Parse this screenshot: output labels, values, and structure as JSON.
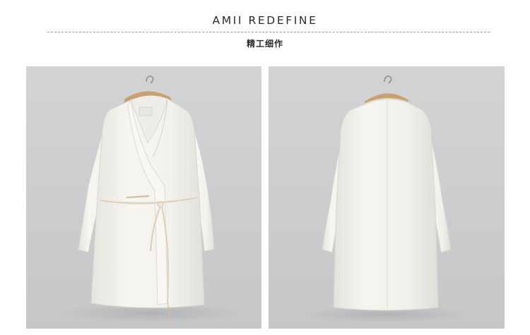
{
  "header": {
    "title": "AMII REDEFINE",
    "subtitle": "精工细作"
  },
  "product_photos": [
    {
      "view": "front",
      "garment": "white-wrap-coat-with-tie-belt"
    },
    {
      "view": "back",
      "garment": "white-wrap-coat"
    }
  ],
  "colors": {
    "background": "#ffffff",
    "photo_backdrop": "#cccdcf",
    "coat_white": "#f4f2ec",
    "hanger_wood": "#c9a06f",
    "divider": "#9a9a9a"
  }
}
